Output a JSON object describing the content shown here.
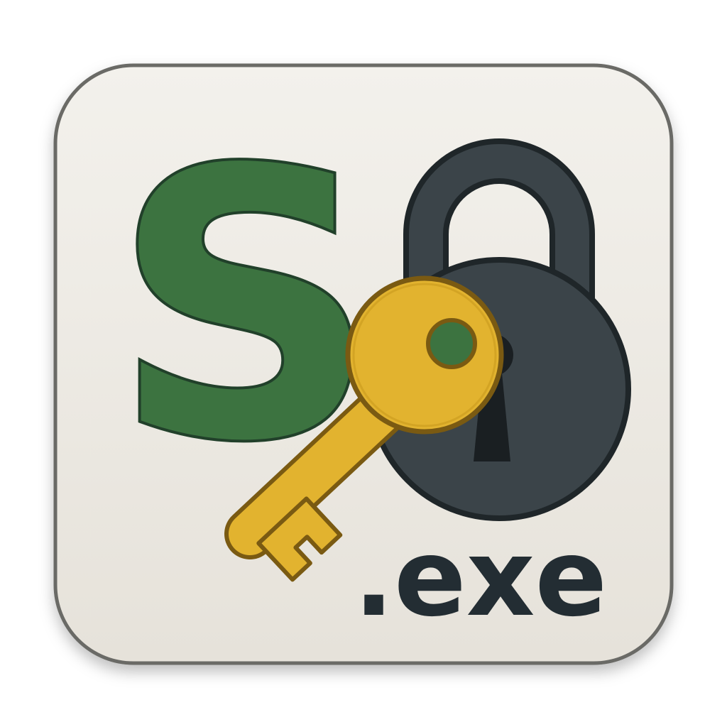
{
  "icon": {
    "letter": "S",
    "extension": ".exe",
    "symbols": [
      "padlock-icon",
      "key-icon"
    ]
  },
  "colors": {
    "tile_background": "#eeebe4",
    "tile_border": "#6a6a66",
    "letter_green": "#3c7340",
    "letter_outline": "#21402a",
    "padlock": "#3b4449",
    "padlock_outline": "#1f2629",
    "key_gold": "#e2b32f",
    "key_outline": "#7a5a12",
    "extension_text": "#232d33"
  }
}
